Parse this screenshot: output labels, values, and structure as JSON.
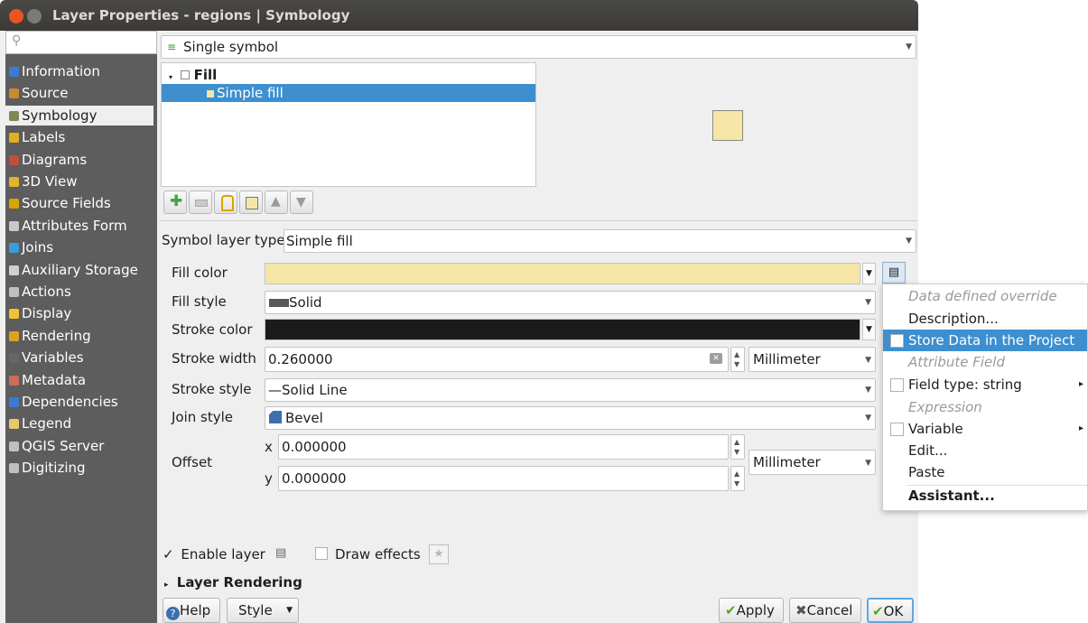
{
  "window": {
    "title": "Layer Properties - regions | Symbology"
  },
  "sidebar": {
    "search_placeholder": "",
    "items": [
      {
        "label": "Information",
        "icon": "info-icon"
      },
      {
        "label": "Source",
        "icon": "source-icon"
      },
      {
        "label": "Symbology",
        "icon": "symbology-icon"
      },
      {
        "label": "Labels",
        "icon": "labels-icon"
      },
      {
        "label": "Diagrams",
        "icon": "diagrams-icon"
      },
      {
        "label": "3D View",
        "icon": "3d-view-icon"
      },
      {
        "label": "Source Fields",
        "icon": "source-fields-icon"
      },
      {
        "label": "Attributes Form",
        "icon": "attributes-form-icon"
      },
      {
        "label": "Joins",
        "icon": "joins-icon"
      },
      {
        "label": "Auxiliary Storage",
        "icon": "auxiliary-storage-icon"
      },
      {
        "label": "Actions",
        "icon": "actions-icon"
      },
      {
        "label": "Display",
        "icon": "display-icon"
      },
      {
        "label": "Rendering",
        "icon": "rendering-icon"
      },
      {
        "label": "Variables",
        "icon": "variables-icon"
      },
      {
        "label": "Metadata",
        "icon": "metadata-icon"
      },
      {
        "label": "Dependencies",
        "icon": "dependencies-icon"
      },
      {
        "label": "Legend",
        "icon": "legend-icon"
      },
      {
        "label": "QGIS Server",
        "icon": "qgis-server-icon"
      },
      {
        "label": "Digitizing",
        "icon": "digitizing-icon"
      }
    ],
    "selected": "Symbology"
  },
  "renderer": {
    "value": "Single symbol"
  },
  "tree": {
    "root": "Fill",
    "child": "Simple fill"
  },
  "symbol_layer_type": {
    "label": "Symbol layer type",
    "value": "Simple fill"
  },
  "form": {
    "fill_color_label": "Fill color",
    "fill_color": "#f5e6a8",
    "fill_style_label": "Fill style",
    "fill_style_value": "Solid",
    "stroke_color_label": "Stroke color",
    "stroke_color": "#1b1b1b",
    "stroke_width_label": "Stroke width",
    "stroke_width_value": "0.260000",
    "stroke_width_unit": "Millimeter",
    "stroke_style_label": "Stroke style",
    "stroke_style_value": "—Solid Line",
    "join_style_label": "Join style",
    "join_style_value": "Bevel",
    "offset_label": "Offset",
    "offset_x_label": "x",
    "offset_x_value": "0.000000",
    "offset_y_label": "y",
    "offset_y_value": "0.000000",
    "offset_unit": "Millimeter"
  },
  "bottom": {
    "enable_layer_label": "Enable layer",
    "enable_layer_checked": true,
    "draw_effects_label": "Draw effects",
    "draw_effects_checked": false,
    "layer_rendering_label": "Layer Rendering"
  },
  "buttons": {
    "help": "Help",
    "style": "Style",
    "apply": "Apply",
    "cancel": "Cancel",
    "ok": "OK"
  },
  "context_menu": {
    "header1": "Data defined override",
    "description": "Description...",
    "store_data": "Store Data in the Project",
    "header2": "Attribute Field",
    "field_type": "Field type: string",
    "header3": "Expression",
    "variable": "Variable",
    "edit": "Edit...",
    "paste": "Paste",
    "assistant": "Assistant..."
  },
  "colors": {
    "selection": "#3d8fcf",
    "preview_fill": "#f5e6a8"
  }
}
